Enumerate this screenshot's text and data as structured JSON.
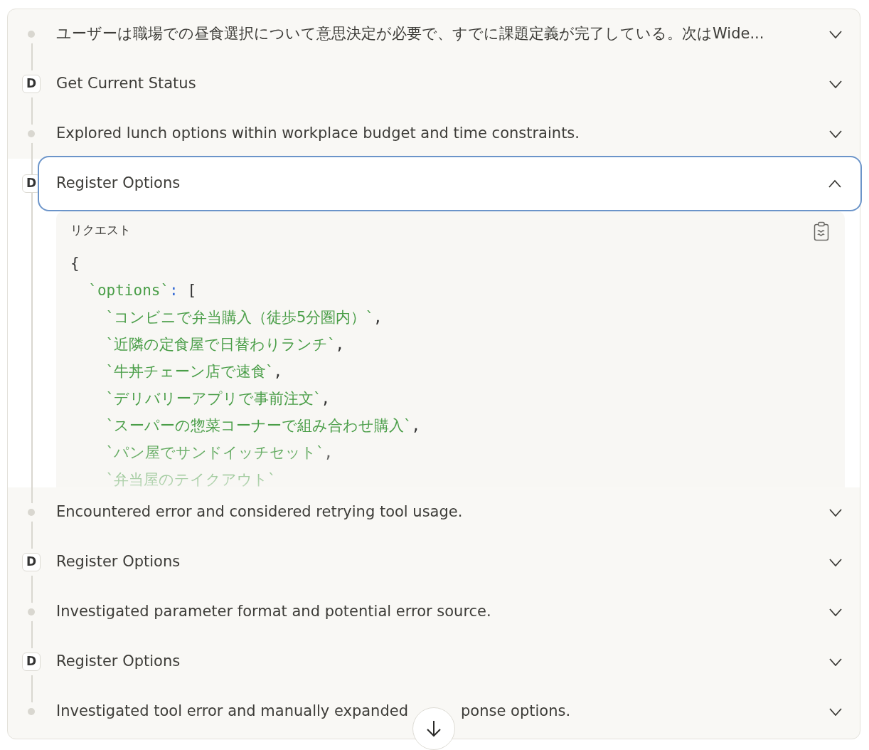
{
  "steps": [
    {
      "kind": "thought",
      "title": "ユーザーは職場での昼食選択について意思決定が必要で、すでに課題定義が完了している。次はWide...",
      "expanded": false
    },
    {
      "kind": "tool",
      "badge": "D",
      "title": "Get Current Status",
      "expanded": false
    },
    {
      "kind": "thought",
      "title": "Explored lunch options within workplace budget and time constraints.",
      "expanded": false
    },
    {
      "kind": "tool",
      "badge": "D",
      "title": "Register Options",
      "expanded": true,
      "request": {
        "label": "リクエスト",
        "code": [
          "{",
          "  `options`: [",
          "    `コンビニで弁当購入（徒歩5分圏内）`,",
          "    `近隣の定食屋で日替わりランチ`,",
          "    `牛丼チェーン店で速食`,",
          "    `デリバリーアプリで事前注文`,",
          "    `スーパーの惣菜コーナーで組み合わせ購入`,",
          "    `パン屋でサンドイッチセット`,",
          "    `弁当屋のテイクアウト`"
        ]
      }
    },
    {
      "kind": "thought",
      "title": "Encountered error and considered retrying tool usage.",
      "expanded": false
    },
    {
      "kind": "tool",
      "badge": "D",
      "title": "Register Options",
      "expanded": false
    },
    {
      "kind": "thought",
      "title": "Investigated parameter format and potential error source.",
      "expanded": false
    },
    {
      "kind": "tool",
      "badge": "D",
      "title": "Register Options",
      "expanded": false
    },
    {
      "kind": "thought",
      "title": "Investigated tool error and manually expanded",
      "title_after_button": "ponse options.",
      "expanded": false
    }
  ]
}
